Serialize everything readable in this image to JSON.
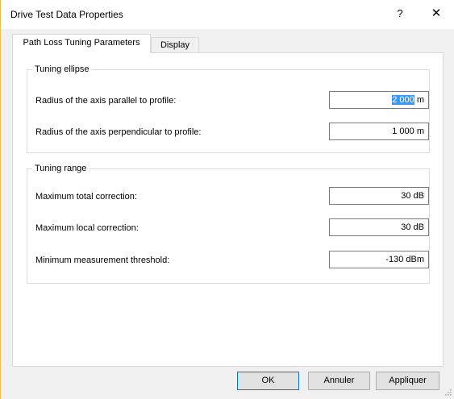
{
  "window": {
    "title": "Drive Test Data Properties",
    "help_label": "?",
    "close_label": "✕"
  },
  "tabs": [
    {
      "label": "Path Loss Tuning Parameters",
      "active": true
    },
    {
      "label": "Display",
      "active": false
    }
  ],
  "tuning_ellipse": {
    "legend": "Tuning ellipse",
    "parallel": {
      "label": "Radius of the axis parallel to profile:",
      "value_selected": "2 000",
      "unit": " m"
    },
    "perpendicular": {
      "label": "Radius of the axis perpendicular to profile:",
      "value": "1 000  m"
    }
  },
  "tuning_range": {
    "legend": "Tuning range",
    "max_total": {
      "label": "Maximum total correction:",
      "value": "30  dB"
    },
    "max_local": {
      "label": "Maximum local correction:",
      "value": "30  dB"
    },
    "min_threshold": {
      "label": "Minimum measurement threshold:",
      "value": "-130  dBm"
    }
  },
  "buttons": {
    "ok": "OK",
    "cancel": "Annuler",
    "apply": "Appliquer"
  },
  "colors": {
    "selection": "#3399ff",
    "default_button_border": "#0078d7"
  }
}
